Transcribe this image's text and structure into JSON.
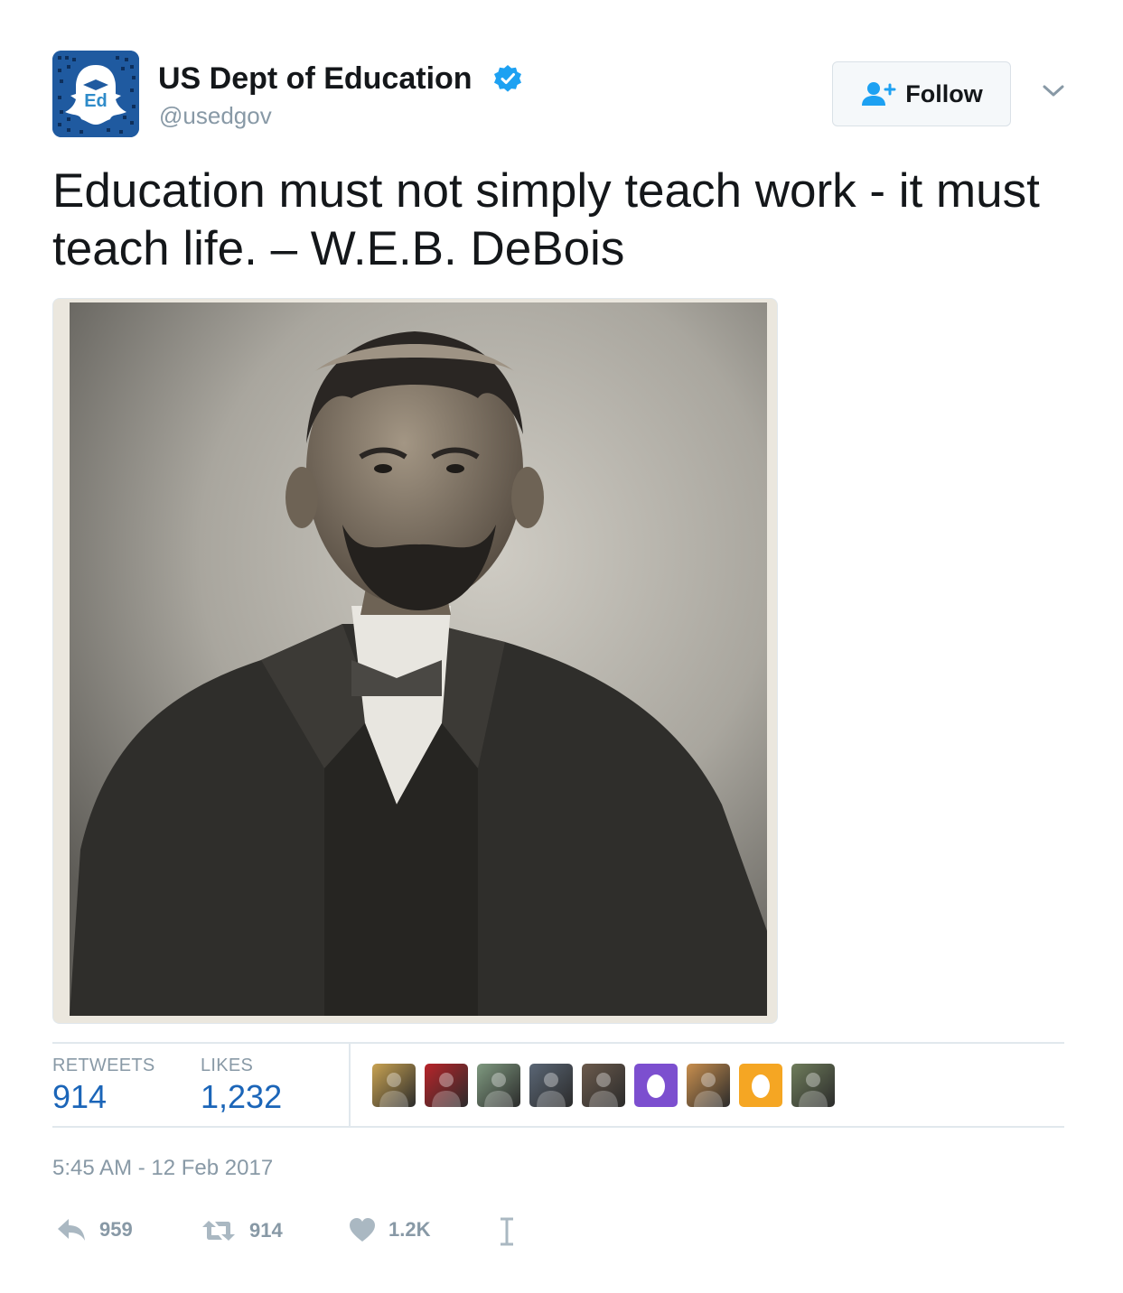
{
  "account": {
    "display_name": "US Dept of Education",
    "handle": "@usedgov",
    "verified_icon": "verified-badge-icon",
    "avatar_logo_text": "Ed"
  },
  "follow_button": {
    "label": "Follow",
    "icon": "add-user-icon"
  },
  "more_menu": {
    "icon": "chevron-down-icon"
  },
  "tweet_text": "Education must not simply teach work - it must teach life. – W.E.B. DeBois",
  "photo": {
    "subject": "portrait-photo"
  },
  "stats": {
    "retweets_label": "RETWEETS",
    "retweets_value": "914",
    "likes_label": "LIKES",
    "likes_value": "1,232"
  },
  "likers": [
    {
      "kind": "photo",
      "color": "#c9a352"
    },
    {
      "kind": "photo",
      "color": "#b8242a"
    },
    {
      "kind": "photo",
      "color": "#7f9a80"
    },
    {
      "kind": "photo",
      "color": "#5a6675"
    },
    {
      "kind": "photo",
      "color": "#6b5a4c"
    },
    {
      "kind": "egg",
      "color": "#7c4fcf"
    },
    {
      "kind": "photo",
      "color": "#c98f4e"
    },
    {
      "kind": "egg",
      "color": "#f5a623"
    },
    {
      "kind": "photo",
      "color": "#6f7d5b"
    }
  ],
  "timestamp": "5:45 AM - 12 Feb 2017",
  "actions": {
    "reply": {
      "icon": "reply-icon",
      "count": "959"
    },
    "retweet": {
      "icon": "retweet-icon",
      "count": "914"
    },
    "like": {
      "icon": "heart-icon",
      "count": "1.2K"
    },
    "text_cursor": {
      "icon": "text-cursor-icon"
    }
  },
  "colors": {
    "link_blue": "#1b65b8",
    "muted_gray": "#8899a6",
    "verified_blue": "#1da1f2",
    "avatar_blue": "#1f5aa0"
  }
}
